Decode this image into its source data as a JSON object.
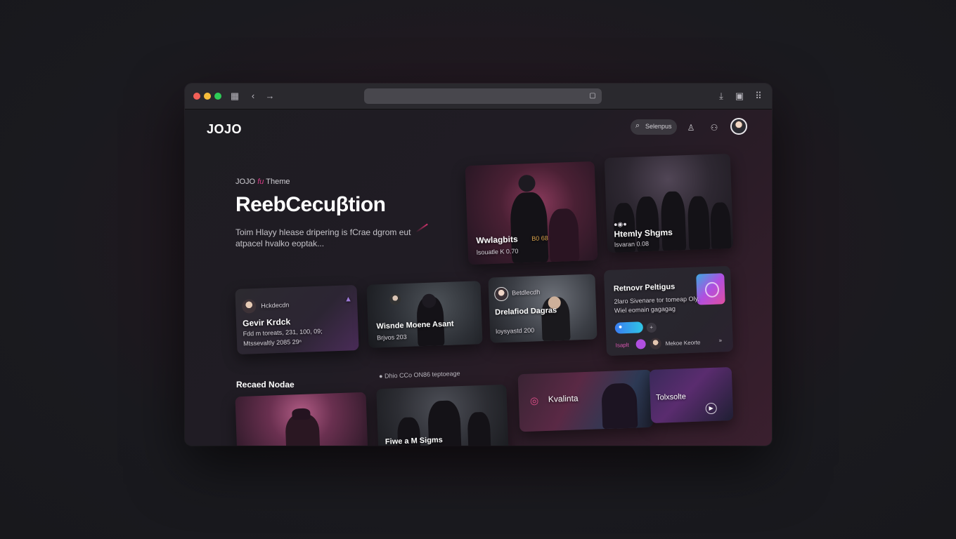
{
  "browser": {
    "traffic_lights": [
      "#f25f57",
      "#f6bd3b",
      "#2ecc57"
    ],
    "icons": [
      "sidebar-icon",
      "back-icon",
      "forward-icon",
      "lock-icon",
      "download-icon",
      "share-icon",
      "grid-icon"
    ]
  },
  "header": {
    "logo": "JOJO",
    "search_label": "Selenpus",
    "icons": [
      "search-icon",
      "user-icon",
      "users-icon"
    ]
  },
  "hero": {
    "kicker_prefix": "JOJO",
    "kicker_accent": "fu",
    "kicker_suffix": "Theme",
    "title": "ReebCecuβtion",
    "subtitle": "Toim Hlayy hlease dripering is fCrae dgrom eut atpacel hvalko eoptak..."
  },
  "cards": {
    "c1": {
      "title": "Wwlagbits",
      "badge": "B0 68",
      "meta": "lsouatle K 0.70"
    },
    "c2": {
      "title": "Htemly Shgms",
      "meta": "lsvaran 0.08"
    },
    "c3": {
      "author": "Hckdecdn",
      "title": "Gevir Krdck",
      "meta_1": "Fdd m toreats, 231, 100, 09;",
      "meta_2": "Mtssevaltly 2085 29ⁿ"
    },
    "c4": {
      "title": "Wisnde Moene Asant",
      "meta": "Brjvos 203"
    },
    "c5": {
      "author": "Betdlecdh",
      "title": "Drelafiod Dagras",
      "meta": "loysyastd 200"
    },
    "c6": {
      "title": "Retnovr Peltigus",
      "desc_1": "2laro Sivenare tor tomeap Oly,",
      "desc_2": "Wiel eomain gagagag",
      "footer_left": "Isaplt",
      "footer_right": "Mekoe Keorte"
    },
    "c7": {},
    "c8": {
      "title": "Fiwe a M Sigms"
    },
    "c9": {
      "title": "Kvalinta"
    },
    "c10": {
      "title": "Tolxsolte"
    }
  },
  "section": {
    "title": "Recaed Nodae",
    "meta": "Dhio CCo ON86 teptoeage"
  },
  "colors": {
    "accent": "#d63c86",
    "cyan": "#2fc6e6",
    "purple": "#b04fe0"
  }
}
